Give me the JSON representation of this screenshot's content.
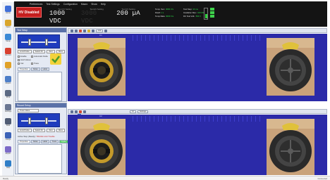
{
  "menu": [
    "Preferences",
    "Test Settings",
    "Configuration",
    "Macro",
    "Show",
    "Help"
  ],
  "header": {
    "hv_button": "HV Disabled",
    "readouts": [
      {
        "caption": "Test HV Setting",
        "value": "1000 VDC",
        "state": "active"
      },
      {
        "caption": "Test HV Setting",
        "value": "3000 VDC",
        "state": "dim"
      },
      {
        "caption": "Test HV Setting",
        "value": "200 µA",
        "state": "active"
      }
    ],
    "stats": [
      {
        "label": "Temp. Set.",
        "value": "3000 V/s"
      },
      {
        "label": "Dwell",
        "value": "1 s"
      },
      {
        "label": "Temp Rate",
        "value": "3000 V/s"
      }
    ],
    "stats2": [
      {
        "label": "Test Step",
        "value": "10 ms"
      },
      {
        "label": "Insulation Res.",
        "value": "100 MΩ"
      },
      {
        "label": "DC Test Volt.",
        "value": "500 V"
      }
    ],
    "battery_level": 0.4
  },
  "tools": [
    {
      "name": "home",
      "label": "Home",
      "color": "#3f6fd8"
    },
    {
      "name": "open",
      "label": "Open",
      "color": "#d9a62d"
    },
    {
      "name": "setup",
      "label": "Setup",
      "color": "#3b8ad6"
    },
    {
      "name": "record",
      "label": "Record",
      "color": "#d8402f"
    },
    {
      "name": "edit",
      "label": "Edit",
      "color": "#e0a128"
    },
    {
      "name": "report",
      "label": "Report",
      "color": "#4d7ec8"
    },
    {
      "name": "print",
      "label": "Print",
      "color": "#5b6a84"
    },
    {
      "name": "settings",
      "label": "Settings",
      "color": "#6a7793"
    },
    {
      "name": "data",
      "label": "Data",
      "color": "#4f5b73"
    },
    {
      "name": "gauge",
      "label": "Gauge",
      "color": "#3b62b7"
    },
    {
      "name": "export",
      "label": "Export",
      "color": "#7c6ac8"
    },
    {
      "name": "help",
      "label": "Help",
      "color": "#2f7ec7"
    }
  ],
  "panel1": {
    "title": "Test Setup",
    "buttons": [
      "Limit Probe",
      "Select Fil.",
      "Zero",
      "More"
    ],
    "checks": [
      "Enable",
      "Automatic Delta",
      "Hold Values",
      "Cal",
      "Trace"
    ],
    "tabs": [
      "Properties",
      "Notes",
      "Label"
    ],
    "viewer_title": "C1"
  },
  "panel2": {
    "title": "Record Setup",
    "field": "Trace Value",
    "buttons": [
      "Limit Probe",
      "Select Fil.",
      "Zero",
      "More"
    ],
    "status_label": "Active Step (Ready):",
    "status_value": "TRACE Limit Trouble",
    "tabs": [
      "Properties",
      "Notes",
      "Label",
      "Tests",
      "Cycle"
    ],
    "viewer_title": "C2"
  },
  "view": {
    "zoom": "100",
    "field1": "10",
    "field2": "Settings"
  },
  "statusbar": {
    "left": "Ready",
    "right": "Connected"
  }
}
